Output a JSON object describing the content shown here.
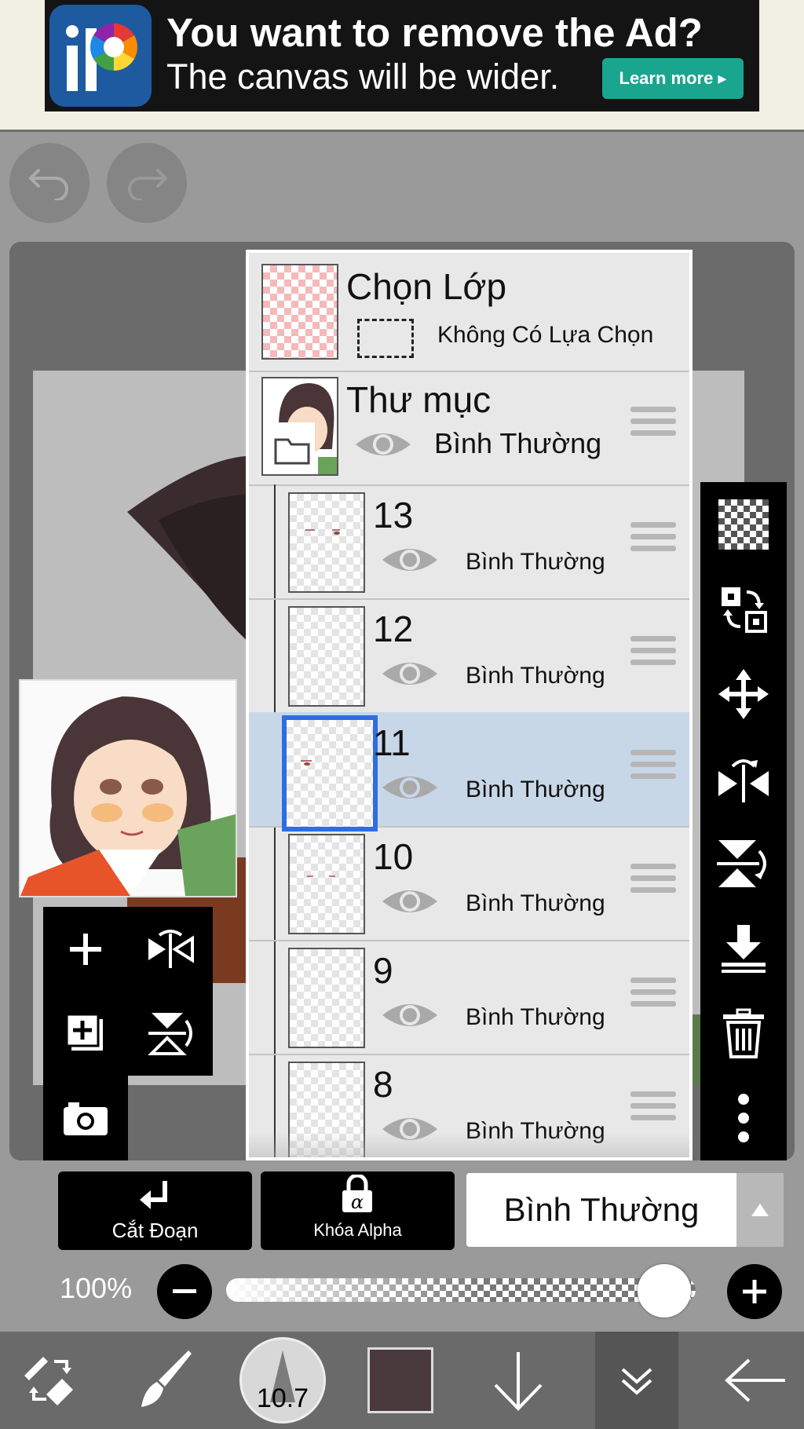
{
  "ad": {
    "title": "You want to remove the Ad?",
    "subtitle": "The canvas will be wider.",
    "cta": "Learn more ▸",
    "logo_icon": "ibispaint-logo-icon"
  },
  "layer_panel": {
    "selection": {
      "title": "Chọn Lớp",
      "status": "Không Có Lựa Chọn"
    },
    "folder": {
      "name": "Thư mục",
      "blend_mode": "Bình Thường"
    },
    "layers": [
      {
        "name": "13",
        "blend_mode": "Bình Thường",
        "selected": false
      },
      {
        "name": "12",
        "blend_mode": "Bình Thường",
        "selected": false
      },
      {
        "name": "11",
        "blend_mode": "Bình Thường",
        "selected": true
      },
      {
        "name": "10",
        "blend_mode": "Bình Thường",
        "selected": false
      },
      {
        "name": "9",
        "blend_mode": "Bình Thường",
        "selected": false
      },
      {
        "name": "8",
        "blend_mode": "Bình Thường",
        "selected": false
      }
    ]
  },
  "right_toolbar": [
    "transparency-icon",
    "swap-layer-icon",
    "move-icon",
    "flip-horizontal-icon",
    "flip-vertical-icon",
    "merge-down-icon",
    "trash-icon",
    "more-icon"
  ],
  "left_tools": [
    "add-layer-icon",
    "flip-horizontal-icon",
    "duplicate-layer-icon",
    "flip-vertical-icon",
    "camera-icon"
  ],
  "controls": {
    "clipping_label": "Cắt Đoạn",
    "alpha_lock_label": "Khóa Alpha",
    "blend_mode_value": "Bình Thường",
    "opacity_text": "100%",
    "opacity_value": 100
  },
  "bottom_bar": {
    "brush_size": "10.7",
    "current_color": "#4a3a3e"
  },
  "colors": {
    "selected_row": "#c8d7e8",
    "selected_border": "#2e6ee0",
    "ad_cta": "#1aa68e"
  }
}
